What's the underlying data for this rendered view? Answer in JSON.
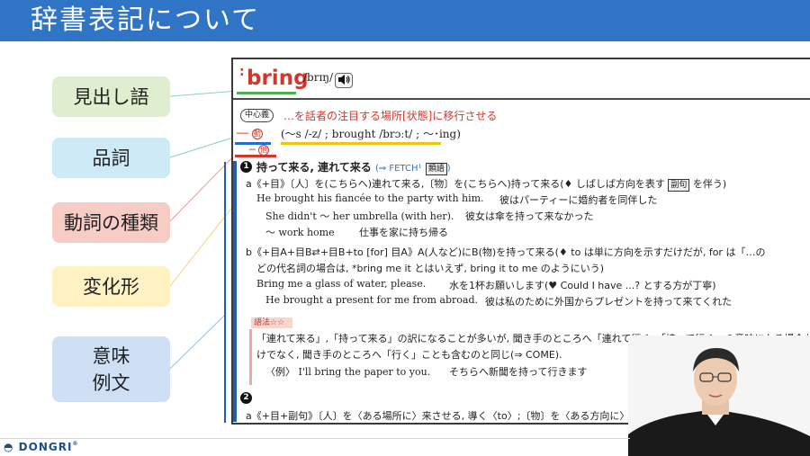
{
  "slide": {
    "title": "辞書表記について",
    "logo": "DONGRI",
    "logo_mark": "®"
  },
  "labels": {
    "entry": "見出し語",
    "pos": "品詞",
    "verb_type": "動詞の種類",
    "inflection": "変化形",
    "meaning_examples": "意味\n例文"
  },
  "dictionary": {
    "headword": "bring",
    "pronunciation": "/brɪŋ/",
    "audio_icon": "speaker-icon",
    "core_badge": "中心義",
    "core_meaning": "…を話者の注目する場所[状態]に移行させる",
    "pos_line1_dash": "──",
    "pos_verb": "動",
    "inflection": "(〜s /-z/ ; brought /brɔːt/ ; 〜･ing)",
    "pos_line2_dash": "─",
    "pos_transitive": "他",
    "sense1": {
      "num": "1",
      "heading": "持って来る, 連れて来る",
      "xref": "(⇒ FETCH¹",
      "tag": "類語",
      "xref_close": ")",
      "a_line": "a《+目》〔人〕を(こちらへ)連れて来る,〔物〕を(こちらへ)持って来る(♦ しばしば方向を表す",
      "a_tag": "副句",
      "a_tail": "を伴う)",
      "ex1_en": "He brought his fiancée to the party with him.",
      "ex1_ja": "彼はパーティーに婚約者を同伴した",
      "ex2_en": "She didn't 〜 her umbrella (with her).",
      "ex2_ja": "彼女は傘を持って来なかった",
      "ex3_en": "〜 work home",
      "ex3_ja": "仕事を家に持ち帰る",
      "b_line": "b《+目A+目B⇄+目B+to [for] 目A》A(人など)にB(物)を持って来る(♦ to は単に方向を示すだけだが, for は「…の",
      "b_line2": "どの代名詞の場合は, *bring me it とはいえず, bring it to me のようにいう)",
      "ex4_en": "Bring me a glass of water, please.",
      "ex4_ja": "水を1杯お願いします(♥ Could I have ...? とする方が丁寧)",
      "ex5_en": "He brought a present for me from abroad.",
      "ex5_ja": "彼は私のために外国からプレゼントを持って来てくれた"
    },
    "usage": {
      "label": "語法☆☆",
      "line1": "「連れて来る」,「持って来る」の訳になることが多いが, 聞き手のところへ「連れて行く」「持って行く」の意味になる場合もあ",
      "line2": "けでなく, 聞き手のところへ「行く」ことも含むのと同じ(⇒ COME).",
      "ex_label": "〈例〉",
      "ex_en": "I'll bring the paper to you.",
      "ex_ja": "そちらへ新聞を持って行きます"
    },
    "sense2": {
      "num": "2",
      "a_line": "a《+目+副句》〔人〕を〈ある場所に〉来させる, 導く〈to〉;〔物〕を〈ある方向に〉動かす"
    }
  }
}
